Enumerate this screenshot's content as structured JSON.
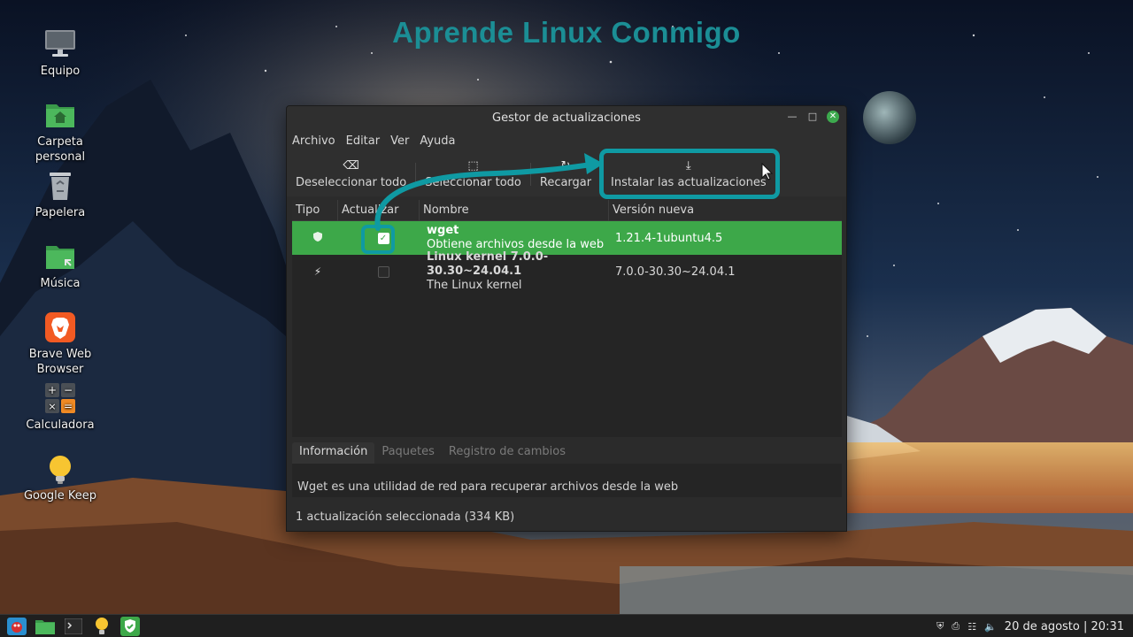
{
  "banner": "Aprende Linux Conmigo",
  "desktop_icons": [
    {
      "label": "Equipo",
      "icon": "computer-icon"
    },
    {
      "label": "Carpeta personal",
      "icon": "home-folder-icon"
    },
    {
      "label": "Papelera",
      "icon": "trash-icon"
    },
    {
      "label": "Música",
      "icon": "music-folder-icon"
    },
    {
      "label": "Brave Web Browser",
      "icon": "brave-icon"
    },
    {
      "label": "Calculadora",
      "icon": "calculator-icon"
    },
    {
      "label": "Google Keep",
      "icon": "keep-icon"
    }
  ],
  "window": {
    "title": "Gestor de actualizaciones",
    "menu": [
      "Archivo",
      "Editar",
      "Ver",
      "Ayuda"
    ],
    "toolbar": {
      "deselect": "Deseleccionar todo",
      "select": "Seleccionar todo",
      "reload": "Recargar",
      "install": "Instalar las actualizaciones"
    },
    "columns": [
      "Tipo",
      "Actualizar",
      "Nombre",
      "Versión nueva"
    ],
    "updates": [
      {
        "type_icon": "shield-icon",
        "checked": true,
        "name": "wget",
        "description": "Obtiene archivos desde la web",
        "version": "1.21.4-1ubuntu4.5"
      },
      {
        "type_icon": "lightning-icon",
        "checked": false,
        "name": "Linux kernel 7.0.0-30.30~24.04.1",
        "description": "The Linux kernel",
        "version": "7.0.0-30.30~24.04.1"
      }
    ],
    "tabs": [
      "Información",
      "Paquetes",
      "Registro de cambios"
    ],
    "info_text": "Wget es una utilidad de red para recuperar archivos desde la web",
    "status": "1 actualización seleccionada (334 KB)"
  },
  "taskbar": {
    "date": "20 de agosto",
    "time": "20:31",
    "separator": "|"
  },
  "colors": {
    "accent_green": "#3da849",
    "highlight_teal": "#0f9aa3",
    "banner": "#1b8e95"
  }
}
